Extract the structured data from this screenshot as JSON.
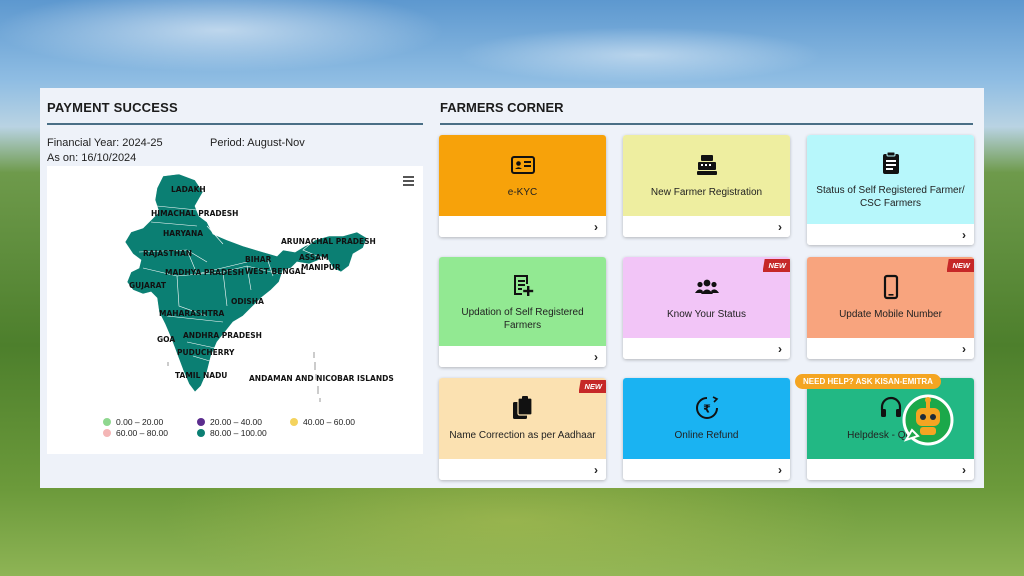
{
  "payment_success": {
    "title": "PAYMENT SUCCESS",
    "financial_year": "Financial Year: 2024-25",
    "period": "Period: August-Nov",
    "as_on": "As on: 16/10/2024",
    "map_labels": {
      "ladakh": "LADAKH",
      "himachal": "HIMACHAL PRADESH",
      "haryana": "HARYANA",
      "rajasthan": "RAJASTHAN",
      "madhya": "MADHYA PRADESH",
      "gujarat": "GUJARAT",
      "maharashtra": "MAHARASHTRA",
      "goa": "GOA",
      "andhra": "ANDHRA PRADESH",
      "puducherry": "PUDUCHERRY",
      "tamil": "TAMIL NADU",
      "odisha": "ODISHA",
      "bihar": "BIHAR",
      "westbengal": "WEST BENGAL",
      "arunachal": "ARUNACHAL PRADESH",
      "assam": "ASSAM",
      "manipur": "MANIPUR",
      "andaman": "ANDAMAN AND NICOBAR ISLANDS"
    },
    "legend": [
      {
        "label": "0.00 – 20.00",
        "color": "#8fd78f"
      },
      {
        "label": "20.00 – 40.00",
        "color": "#5b2d8e"
      },
      {
        "label": "40.00 – 60.00",
        "color": "#f4d35e"
      },
      {
        "label": "60.00 – 80.00",
        "color": "#f4b6b6"
      },
      {
        "label": "80.00 – 100.00",
        "color": "#0b7f73"
      }
    ],
    "map_color": "#0b7f73"
  },
  "farmers_corner": {
    "title": "FARMERS CORNER",
    "tiles": [
      {
        "label": "e-KYC",
        "color": "#f7a20a",
        "icon": "id-card-icon"
      },
      {
        "label": "New Farmer Registration",
        "color": "#eeeea0",
        "icon": "cash-register-icon"
      },
      {
        "label": "Status of Self Registered Farmer/ CSC Farmers",
        "color": "#b7f7fb",
        "icon": "clipboard-icon"
      },
      {
        "label": "Updation of Self Registered Farmers",
        "color": "#92e992",
        "icon": "edit-list-icon"
      },
      {
        "label": "Know Your Status",
        "color": "#f2c5f7",
        "icon": "users-icon",
        "badge": "NEW"
      },
      {
        "label": "Update Mobile Number",
        "color": "#f8a47e",
        "icon": "mobile-icon",
        "badge": "NEW"
      },
      {
        "label": "Name Correction as per Aadhaar",
        "color": "#fbe1b1",
        "icon": "copy-icon",
        "badge": "NEW"
      },
      {
        "label": "Online Refund",
        "color": "#1ab3f2",
        "icon": "rupee-refund-icon"
      },
      {
        "label": "Helpdesk - Query F",
        "color": "#22b884",
        "icon": "headset-icon"
      }
    ],
    "help_pill": "NEED HELP? ASK KISAN-EMITRA",
    "chevron": "›"
  }
}
